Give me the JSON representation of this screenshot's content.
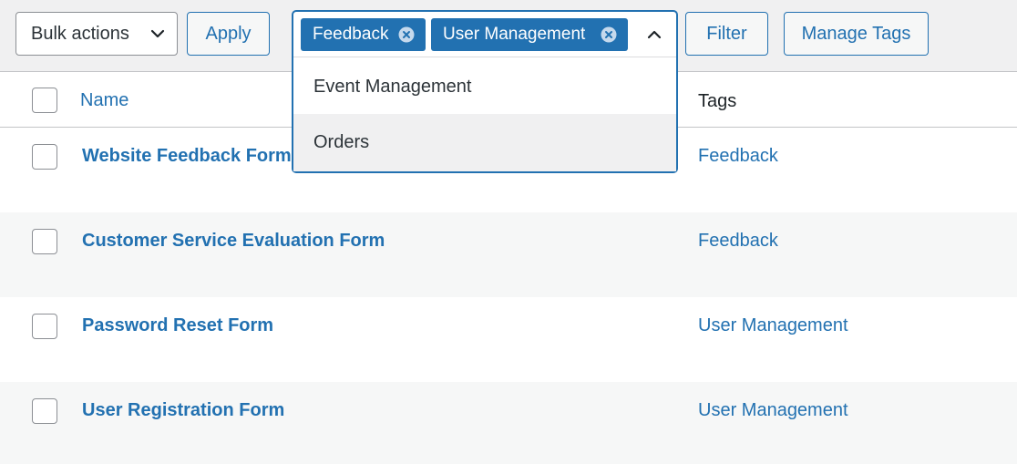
{
  "toolbar": {
    "bulk_actions": "Bulk actions",
    "apply": "Apply",
    "filter": "Filter",
    "manage_tags": "Manage Tags"
  },
  "tag_select": {
    "selected": [
      "Feedback",
      "User Management"
    ],
    "options": [
      "Event Management",
      "Orders"
    ],
    "highlighted_option": "Orders"
  },
  "table": {
    "columns": {
      "name": "Name",
      "tags": "Tags"
    },
    "rows": [
      {
        "name": "Website Feedback Form",
        "tag": "Feedback"
      },
      {
        "name": "Customer Service Evaluation Form",
        "tag": "Feedback"
      },
      {
        "name": "Password Reset Form",
        "tag": "User Management"
      },
      {
        "name": "User Registration Form",
        "tag": "User Management"
      }
    ]
  },
  "colors": {
    "accent": "#2271b1",
    "background": "#f0f0f1",
    "row_alt": "#f6f7f7",
    "text": "#1d2327"
  },
  "icons": {
    "bulk_dropdown": "chevron-down-icon",
    "chip_remove": "close-circle-icon",
    "select_toggle": "chevron-up-icon"
  }
}
